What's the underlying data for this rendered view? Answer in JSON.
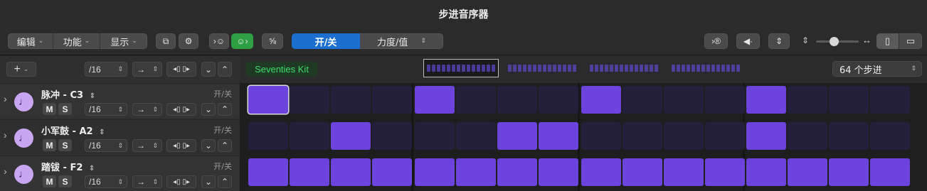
{
  "window": {
    "title": "步进音序器"
  },
  "toolbar": {
    "menus": [
      "编辑",
      "功能",
      "显示"
    ],
    "onoff_label": "开/关",
    "velocity_label": "力度/值"
  },
  "header": {
    "add_label": "+",
    "rate": "/16",
    "kit_name": "Seventies Kit",
    "step_count": "64 个步进"
  },
  "rows": [
    {
      "name": "脉冲 - C3",
      "mode_label": "开/关",
      "mute": "M",
      "solo": "S",
      "rate": "/16",
      "steps": [
        1,
        0,
        0,
        0,
        1,
        0,
        0,
        0,
        1,
        0,
        0,
        0,
        1,
        0,
        0,
        0
      ],
      "current": 0
    },
    {
      "name": "小军鼓 - A2",
      "mode_label": "开/关",
      "mute": "M",
      "solo": "S",
      "rate": "/16",
      "steps": [
        0,
        0,
        1,
        0,
        0,
        0,
        1,
        1,
        0,
        0,
        0,
        0,
        1,
        0,
        0,
        0
      ]
    },
    {
      "name": "踏钹 - F2",
      "mode_label": "开/关",
      "mute": "M",
      "solo": "S",
      "rate": "/16",
      "steps": [
        1,
        1,
        1,
        1,
        1,
        1,
        1,
        1,
        1,
        1,
        1,
        1,
        1,
        1,
        1,
        1
      ]
    }
  ],
  "colors": {
    "step_on": "#6c43dc",
    "step_off": "#241f3a",
    "accent_blue": "#1c6fcf",
    "accent_green": "#2ea043"
  }
}
